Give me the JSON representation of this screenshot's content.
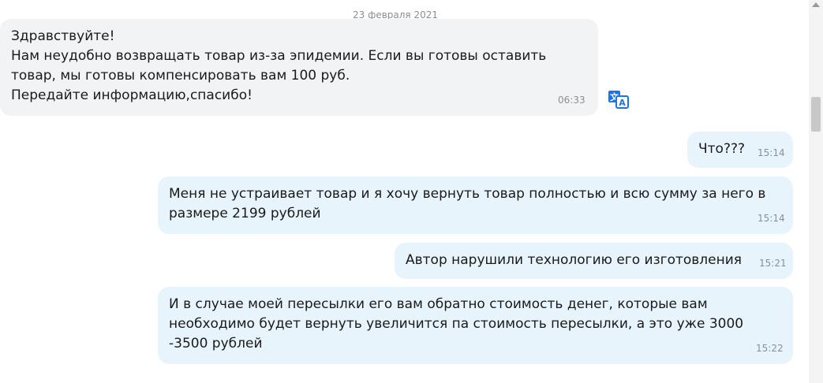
{
  "date_separator": "23 февраля 2021",
  "messages": [
    {
      "direction": "in",
      "text": "Здравствуйте!\nНам неудобно возвращать товар из-за эпидемии. Если вы готовы оставить товар, мы готовы компенсировать вам 100 руб.\nПередайте информацию,спасибо!",
      "time": "06:33"
    },
    {
      "direction": "out",
      "text": "Что???",
      "time": "15:14"
    },
    {
      "direction": "out",
      "text": "Меня не устраивает товар и я хочу вернуть товар полностью и всю сумму за него в размере 2199 рублей",
      "time": "15:14"
    },
    {
      "direction": "out",
      "text": "Автор нарушили технологию его изготовления",
      "time": "15:21"
    },
    {
      "direction": "out",
      "text": "И в случае моей пересылки его вам обратно стоимость денег, которые вам необходимо будет вернуть увеличится па стоимость пересылки, а это уже 3000 -3500 рублей",
      "time": "15:22"
    }
  ],
  "icons": {
    "translate": "translate-icon"
  },
  "colors": {
    "incoming_bubble": "#f2f3f5",
    "outgoing_bubble": "#e8f4fc",
    "accent": "#1a73e8",
    "timestamp": "#8a8f96"
  }
}
